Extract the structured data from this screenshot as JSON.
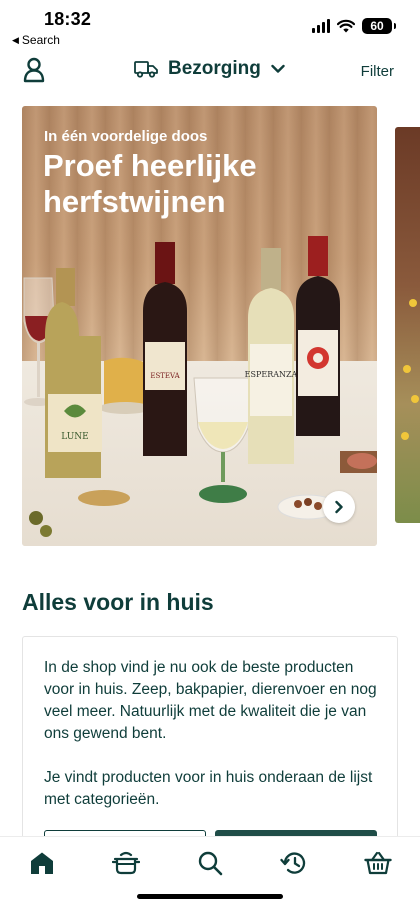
{
  "status_bar": {
    "time": "18:32",
    "back_label": "Search",
    "battery": "60"
  },
  "header": {
    "profile_icon": "person-icon",
    "delivery_label": "Bezorging",
    "filter_label": "Filter"
  },
  "hero": {
    "kicker": "In één voordelige doos",
    "title": "Proef heerlijke herfstwijnen",
    "next_icon": "chevron-right-icon"
  },
  "section": {
    "title": "Alles voor in huis",
    "paragraph_1": "In de shop vind je nu ook de beste producten voor in huis. Zeep, bakpapier, dierenvoer en nog veel meer. Natuurlijk met de kwaliteit die je van ons gewend bent.",
    "paragraph_2": "Je vindt producten voor in huis onderaan de lijst met categorieën."
  },
  "bottom_nav": {
    "items": [
      {
        "icon": "home-icon",
        "active": true
      },
      {
        "icon": "cooking-pot-icon",
        "active": false
      },
      {
        "icon": "search-icon",
        "active": false
      },
      {
        "icon": "history-icon",
        "active": false
      },
      {
        "icon": "basket-icon",
        "active": false
      }
    ]
  },
  "colors": {
    "primary": "#0f3d3a",
    "button_dark": "#1f4d48"
  }
}
